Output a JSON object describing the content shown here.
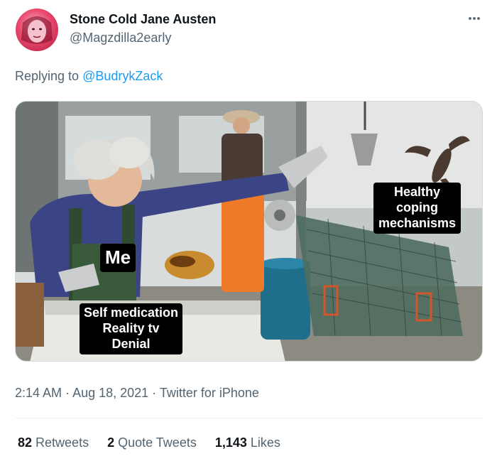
{
  "author": {
    "display_name": "Stone Cold Jane Austen",
    "handle": "@Magzdilla2early"
  },
  "reply": {
    "prefix": "Replying to ",
    "mention": "@BudrykZack"
  },
  "media": {
    "labels": {
      "me": "Me",
      "self": "Self medication\nReality tv\nDenial",
      "healthy": "Healthy\ncoping\nmechanisms"
    }
  },
  "meta": {
    "time": "2:14 AM",
    "sep1": " · ",
    "date": "Aug 18, 2021",
    "sep2": " · ",
    "source": "Twitter for iPhone"
  },
  "stats": {
    "retweets_count": "82",
    "retweets_label": " Retweets",
    "quotes_count": "2",
    "quotes_label": " Quote Tweets",
    "likes_count": "1,143",
    "likes_label": " Likes"
  },
  "colors": {
    "link": "#1d9bf0",
    "secondary_text": "#536471",
    "primary_text": "#0f1419"
  },
  "icons": {
    "more": "more-horizontal-icon"
  }
}
